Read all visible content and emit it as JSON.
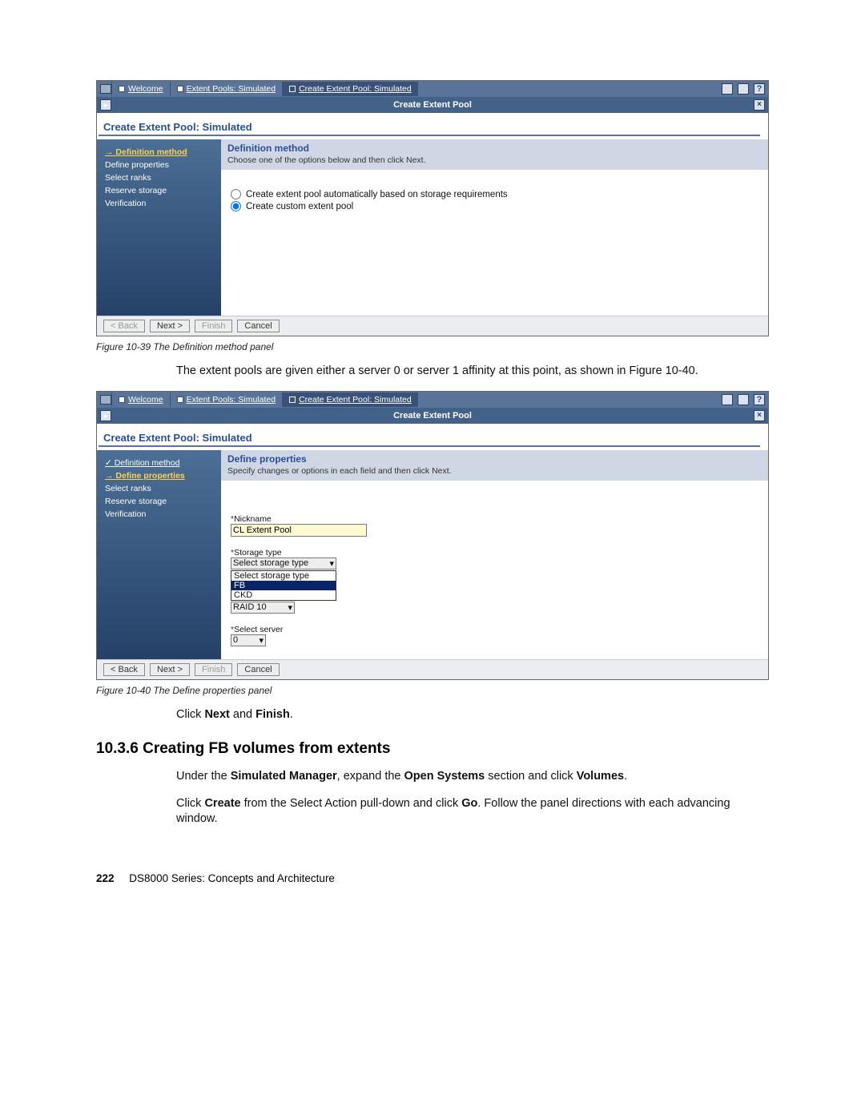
{
  "topbar": {
    "tabs": [
      {
        "label": "Welcome",
        "active": false
      },
      {
        "label": "Extent Pools: Simulated",
        "active": false
      },
      {
        "label": "Create Extent Pool: Simulated",
        "active": true
      }
    ]
  },
  "titlebar": {
    "title": "Create Extent Pool"
  },
  "subtitle": "Create Extent Pool: Simulated",
  "panel39": {
    "steps": [
      {
        "label": "Definition method",
        "state": "current"
      },
      {
        "label": "Define properties",
        "state": "todo"
      },
      {
        "label": "Select ranks",
        "state": "todo"
      },
      {
        "label": "Reserve storage",
        "state": "todo"
      },
      {
        "label": "Verification",
        "state": "todo"
      }
    ],
    "head": {
      "title": "Definition method",
      "desc": "Choose one of the options below and then click Next."
    },
    "options": [
      {
        "label": "Create extent pool automatically based on storage requirements",
        "selected": false
      },
      {
        "label": "Create custom extent pool",
        "selected": true
      }
    ],
    "buttons": {
      "back": "< Back",
      "next": "Next >",
      "finish": "Finish",
      "cancel": "Cancel"
    },
    "caption": "Figure 10-39   The Definition method panel"
  },
  "para_between": "The extent pools are given either a server 0 or server 1 affinity at this point, as shown in Figure 10-40.",
  "panel40": {
    "steps": [
      {
        "label": "Definition method",
        "state": "done"
      },
      {
        "label": "Define properties",
        "state": "current"
      },
      {
        "label": "Select ranks",
        "state": "todo"
      },
      {
        "label": "Reserve storage",
        "state": "todo"
      },
      {
        "label": "Verification",
        "state": "todo"
      }
    ],
    "head": {
      "title": "Define properties",
      "desc": "Specify changes or options in each field and then click Next."
    },
    "nickname": {
      "label": "Nickname",
      "value": "CL Extent Pool"
    },
    "storage_type": {
      "label": "Storage type",
      "selected": "Select storage type",
      "options": [
        "Select storage type",
        "FB",
        "CKD"
      ],
      "highlighted": "FB",
      "raid": "RAID 10"
    },
    "server": {
      "label": "Select server",
      "value": "0"
    },
    "buttons": {
      "back": "< Back",
      "next": "Next >",
      "finish": "Finish",
      "cancel": "Cancel"
    },
    "caption": "Figure 10-40   The Define properties panel"
  },
  "after_panel40": {
    "instr_prefix": "Click ",
    "next_bold": "Next",
    "instr_and": " and ",
    "finish_bold": "Finish",
    "instr_suffix": ".",
    "section_heading": "10.3.6  Creating FB volumes from extents",
    "p1_pre": "Under the ",
    "p1_b1": "Simulated Manager",
    "p1_mid": ", expand the ",
    "p1_b2": "Open Systems",
    "p1_mid2": " section and click ",
    "p1_b3": "Volumes",
    "p1_end": ".",
    "p2_pre": "Click ",
    "p2_b1": "Create",
    "p2_mid": " from the Select Action pull-down and click ",
    "p2_b2": "Go",
    "p2_end": ". Follow the panel directions with each advancing window."
  },
  "footer": {
    "page": "222",
    "title": "DS8000 Series: Concepts and Architecture"
  }
}
